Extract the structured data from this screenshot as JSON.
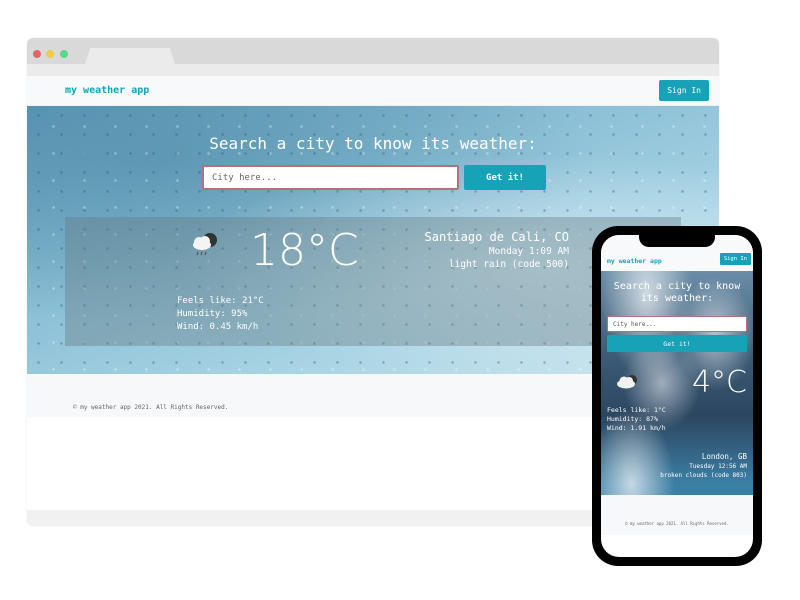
{
  "desktop": {
    "window_controls": [
      "close",
      "minimize",
      "maximize"
    ],
    "nav": {
      "brand": "my weather app",
      "signin_label": "Sign In"
    },
    "hero": {
      "title": "Search a city to know its weather:",
      "input_placeholder": "City here...",
      "input_value": "",
      "button_label": "Get it!"
    },
    "weather": {
      "icon": "rain-cloud-night-icon",
      "temperature": "18°C",
      "feels_like": "Feels like: 21°C",
      "humidity": "Humidity: 95%",
      "wind": "Wind: 0.45 km/h",
      "location": "Santiago de Cali, CO",
      "datetime": "Monday 1:09 AM",
      "description": "light rain (code 500)"
    },
    "footer": {
      "text": "© my weather app 2021. All Rights Reserved."
    }
  },
  "mobile": {
    "nav": {
      "brand": "my weather app",
      "signin_label": "Sign In"
    },
    "hero": {
      "title": "Search a city to know its weather:",
      "input_placeholder": "City here...",
      "input_value": "",
      "button_label": "Get it!"
    },
    "weather": {
      "icon": "cloud-icon",
      "temperature": "4°C",
      "feels_like": "Feels like: 1°C",
      "humidity": "Humidity: 87%",
      "wind": "Wind: 1.91 km/h",
      "location": "London, GB",
      "datetime": "Tuesday 12:56 AM",
      "description": "broken clouds (code 803)"
    },
    "footer": {
      "text": "© my weather app 2021. All Rights Reserved."
    }
  },
  "colors": {
    "accent": "#17a2b8",
    "input_border": "#b5707a"
  }
}
